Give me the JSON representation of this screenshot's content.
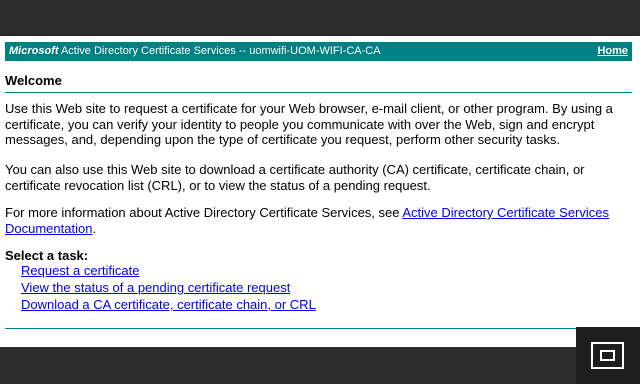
{
  "header": {
    "brand": "Microsoft",
    "title": "Active Directory Certificate Services  --  uomwifi-UOM-WIFI-CA-CA",
    "home_link": "Home"
  },
  "welcome": "Welcome",
  "paragraphs": {
    "intro": "Use this Web site to request a certificate for your Web browser, e-mail client, or other program. By using a certificate, you can verify your identity to people you communicate with over the Web, sign and encrypt messages, and, depending upon the type of certificate you request, perform other security tasks.",
    "download": "You can also use this Web site to download a certificate authority (CA) certificate, certificate chain, or certificate revocation list (CRL), or to view the status of a pending request.",
    "more_info_prefix": "For more information about Active Directory Certificate Services, see ",
    "more_info_link": "Active Directory Certificate Services Documentation",
    "more_info_suffix": "."
  },
  "tasks": {
    "title": "Select a task:",
    "items": [
      "Request a certificate",
      "View the status of a pending certificate request",
      "Download a CA certificate, certificate chain, or CRL"
    ]
  },
  "colors": {
    "header_bg": "#008080",
    "link": "#0000ee"
  },
  "icons": {
    "fullscreen": "exit-fullscreen-icon"
  }
}
